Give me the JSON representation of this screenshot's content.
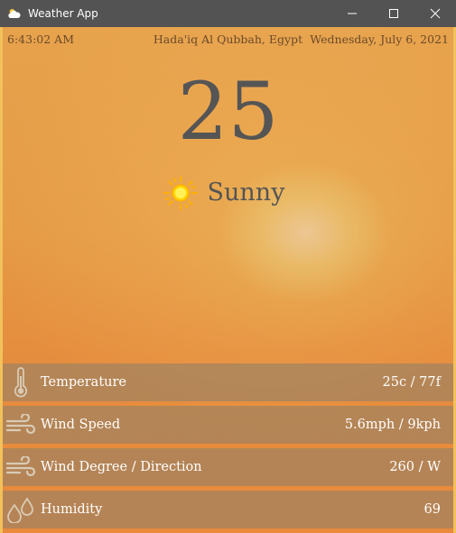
{
  "window": {
    "title": "Weather App",
    "controls": {
      "minimize": "minimize",
      "maximize": "maximize",
      "close": "close"
    }
  },
  "header": {
    "time": "6:43:02 AM",
    "location": "Hada'iq Al Qubbah, Egypt",
    "date": "Wednesday, July 6, 2021"
  },
  "current": {
    "temperature": "25",
    "condition": "Sunny",
    "condition_icon": "sun-icon"
  },
  "stats": [
    {
      "label": "Temperature",
      "value": "25c / 77f",
      "icon": "thermometer-icon"
    },
    {
      "label": "Wind Speed",
      "value": "5.6mph / 9kph",
      "icon": "wind-icon"
    },
    {
      "label": "Wind Degree / Direction",
      "value": "260 / W",
      "icon": "wind-icon"
    },
    {
      "label": "Humidity",
      "value": "69",
      "icon": "droplets-icon"
    }
  ],
  "colors": {
    "titlebar": "#535353",
    "background": "#e59a45",
    "border_accent": "#f2c15c",
    "stat_panel": "#928068",
    "sun": "#ffd400",
    "text_dark": "#555555"
  }
}
